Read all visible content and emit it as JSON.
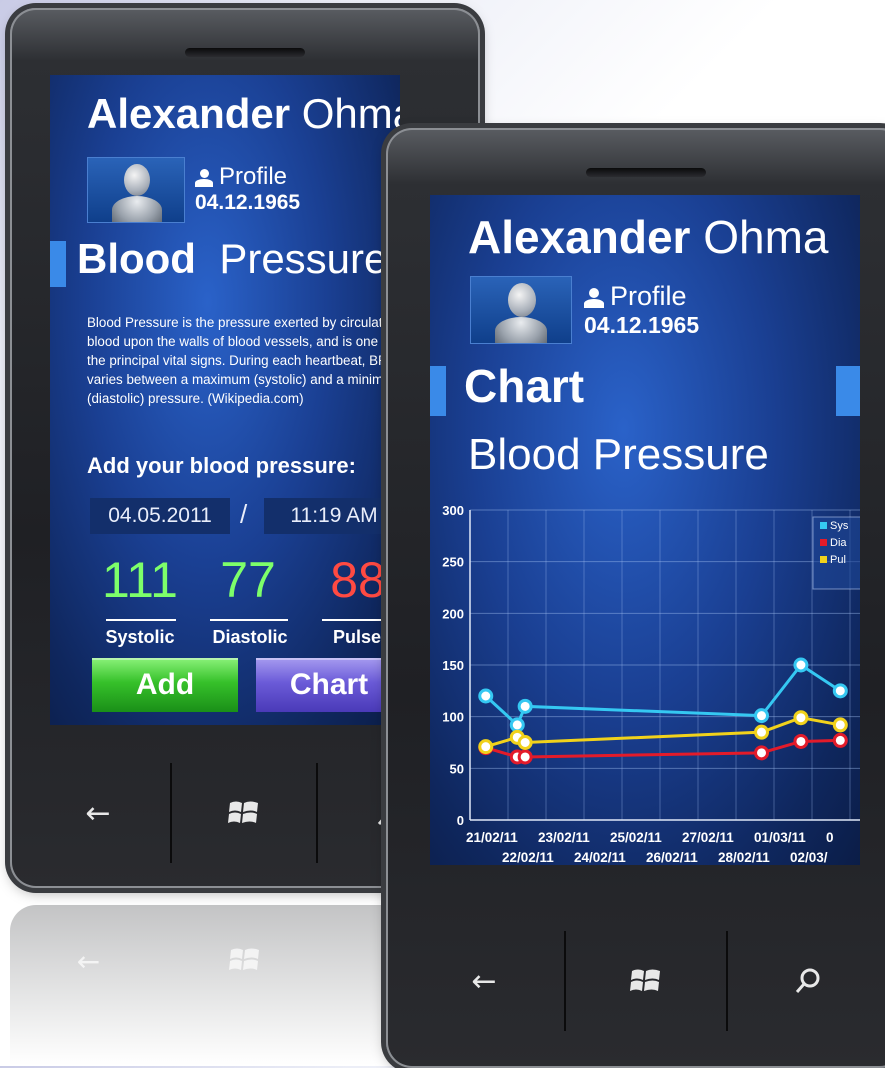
{
  "user": {
    "first_name": "Alexander",
    "last_name_back": "Ohma",
    "last_name_front": "Ohma",
    "profile_label": "Profile",
    "birth_date": "04.12.1965"
  },
  "back_screen": {
    "section_title_bold": "Blood",
    "section_title_light": "Pressure",
    "description": "Blood Pressure is the pressure exerted by circulating blood upon the walls of blood vessels, and is one of the principal vital signs. During each heartbeat, BP varies between a maximum (systolic) and a minimum (diastolic) pressure. (Wikipedia.com)",
    "add_heading": "Add your blood pressure:",
    "date_value": "04.05.2011",
    "separator": "/",
    "time_value": "11:19 AM",
    "systolic_value": "111",
    "systolic_label": "Systolic",
    "diastolic_value": "77",
    "diastolic_label": "Diastolic",
    "pulse_value": "88",
    "pulse_label": "Pulse",
    "add_button": "Add",
    "chart_button": "Chart"
  },
  "front_screen": {
    "section_title": "Chart",
    "chart_title": "Blood Pressure"
  },
  "hardware": {
    "back_icon": "back-arrow-icon",
    "start_icon": "windows-logo-icon",
    "search_icon": "search-icon",
    "back_glyph": "←"
  },
  "colors": {
    "systolic_value": "#7dff6a",
    "diastolic_value": "#7dff6a",
    "pulse_value": "#ff4a42",
    "accent": "#3a8ae8",
    "systolic_series": "#35c8f2",
    "diastolic_series": "#e31b2a",
    "pulse_series": "#f1d21b"
  },
  "chart_data": {
    "type": "line",
    "x_tick_labels_row1": [
      "21/02/11",
      "23/02/11",
      "25/02/11",
      "27/02/11",
      "01/03/11",
      "0"
    ],
    "x_tick_labels_row2": [
      "22/02/11",
      "24/02/11",
      "26/02/11",
      "28/02/11",
      "02/03/"
    ],
    "ylim": [
      0,
      300
    ],
    "y_ticks": [
      "0",
      "50",
      "100",
      "150",
      "200",
      "250",
      "300"
    ],
    "grid": true,
    "legend_position": "top-right",
    "legend": [
      "Sys",
      "Dia",
      "Pul"
    ],
    "x": [
      21.0,
      21.8,
      22.0,
      28.0,
      29.0,
      30.0
    ],
    "series": [
      {
        "name": "Sys",
        "color": "#35c8f2",
        "values": [
          120,
          92,
          110,
          101,
          150,
          125
        ]
      },
      {
        "name": "Dia",
        "color": "#e31b2a",
        "values": [
          70,
          61,
          61,
          65,
          76,
          77
        ]
      },
      {
        "name": "Pul",
        "color": "#f1d21b",
        "values": [
          71,
          80,
          75,
          85,
          99,
          92
        ]
      }
    ]
  }
}
